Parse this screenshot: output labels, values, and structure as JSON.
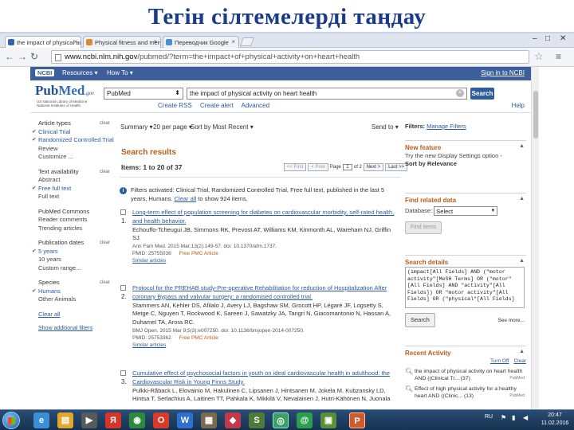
{
  "slide": {
    "title": "Тегін сілтемелерді таңдау"
  },
  "browser": {
    "tabs": [
      {
        "label": "the impact of physical act",
        "active": true
      },
      {
        "label": "Physical fitness and mental",
        "active": false
      },
      {
        "label": "Переводчик Google",
        "active": false
      }
    ],
    "url_host": "www.ncbi.nlm.nih.gov",
    "url_path": "/pubmed/?term=the+impact+of+physical+activity+on+heart+health"
  },
  "ncbi_bar": {
    "logo": "NCBI",
    "resources": "Resources ▾",
    "howto": "How To ▾",
    "signin": "Sign in to NCBI"
  },
  "pubmed": {
    "logo_pub": "Pub",
    "logo_med": "Med",
    "logo_gov": ".gov",
    "subtitle": "US National Library of Medicine National Institutes of Health",
    "db_select": "PubMed",
    "query": "the impact of physical activity on heart health",
    "search_label": "Search",
    "links": [
      "Create RSS",
      "Create alert",
      "Advanced"
    ],
    "help": "Help"
  },
  "sidebar": {
    "groups": [
      {
        "head": "Article types",
        "clear": "clear",
        "items": [
          {
            "label": "Clinical Trial",
            "sel": true
          },
          {
            "label": "Randomized Controlled Trial",
            "sel": true
          },
          {
            "label": "Review",
            "sel": false
          },
          {
            "label": "Customize ...",
            "sel": false
          }
        ]
      },
      {
        "head": "Text availability",
        "clear": "clear",
        "items": [
          {
            "label": "Abstract",
            "sel": false
          },
          {
            "label": "Free full text",
            "sel": true
          },
          {
            "label": "Full text",
            "sel": false
          }
        ]
      },
      {
        "head": "PubMed Commons",
        "clear": "",
        "items": [
          {
            "label": "Reader comments",
            "sel": false
          },
          {
            "label": "Trending articles",
            "sel": false
          }
        ]
      },
      {
        "head": "Publication dates",
        "clear": "clear",
        "items": [
          {
            "label": "5 years",
            "sel": true
          },
          {
            "label": "10 years",
            "sel": false
          },
          {
            "label": "Custom range...",
            "sel": false
          }
        ]
      },
      {
        "head": "Species",
        "clear": "clear",
        "items": [
          {
            "label": "Humans",
            "sel": true
          },
          {
            "label": "Other Animals",
            "sel": false
          }
        ]
      }
    ],
    "clear_all": "Clear all",
    "show_additional": "Show additional filters"
  },
  "results": {
    "summary": "Summary ▾",
    "per_page": "20 per page ▾",
    "sort": "Sort by Most Recent ▾",
    "send_to": "Send to ▾",
    "heading": "Search results",
    "items_line": "Items: 1 to 20 of 37",
    "pager": {
      "first": "<< First",
      "prev": "< Prev",
      "page_label": "Page",
      "page": "1",
      "of": "of 2",
      "next": "Next >",
      "last": "Last >>"
    },
    "filter_note": "Filters activated: Clinical Trial, Randomized Controlled Trial, Free full text, published in the last 5 years, Humans.",
    "filter_clear": "Clear all",
    "filter_tail": "to show 924 items.",
    "list": [
      {
        "num": "1.",
        "title": "Long-term effect of population screening for diabetes on cardiovascular morbidity, self-rated health, and health behavior.",
        "authors": "Echouffo-Tcheugui JB, Simmons RK, Prevost AT, Williams KM, Kinmonth AL, Wareham NJ, Griffin SJ.",
        "source": "Ann Fam Med. 2015 Mar;13(2):149-57. doi: 10.1370/afm.1737.",
        "pmid": "PMID: 25755036",
        "free": "Free PMC Article",
        "similar": "Similar articles"
      },
      {
        "num": "2.",
        "title": "Protocol for the PREHAB study-Pre-operative Rehabilitation for reduction of Hospitalization After coronary Bypass and valvular surgery: a randomised controlled trial.",
        "authors": "Stammers AN, Kehler DS, Afilalo J, Avery LJ, Bagshaw SM, Grocott HP, Légaré JF, Logsetty S, Metge C, Nguyen T, Rockwood K, Sareen J, Sawatzky JA, Tangri N, Giacomantonio N, Hassan A, Duhamel TA, Arora RC.",
        "source": "BMJ Open. 2015 Mar 9;5(3):e007250. doi: 10.1136/bmjopen-2014-007250.",
        "pmid": "PMID: 25753362",
        "free": "Free PMC Article",
        "similar": "Similar articles"
      },
      {
        "num": "3.",
        "title": "Cumulative effect of psychosocial factors in youth on ideal cardiovascular health in adulthood: the Cardiovascular Risk in Young Finns Study.",
        "authors": "Pulkki-Råback L, Elovainio M, Hakulinen C, Lipsanen J, Hintsanen M, Jokela M, Kubzansky LD, Hintsa T, Serlachius A, Laitinen TT, Pahkala K, Mikkilä V, Nevalainen J, Hutri-Kähönen N, Juonala"
      }
    ]
  },
  "right": {
    "filters_label": "Filters:",
    "manage_filters": "Manage Filters",
    "new_feature": {
      "title": "New feature",
      "line1": "Try the new Display Settings option -",
      "line2": "Sort by Relevance"
    },
    "related": {
      "title": "Find related data",
      "db_label": "Database:",
      "db_value": "Select",
      "find_items": "Find items"
    },
    "details": {
      "title": "Search details",
      "query": "(impact[All Fields] AND (\"motor activity\"[MeSH Terms] OR (\"motor\"[All Fields] AND \"activity\"[All Fields]) OR \"motor activity\"[All Fields] OR (\"physical\"[All Fields]",
      "search": "Search",
      "see_more": "See more..."
    },
    "activity": {
      "title": "Recent Activity",
      "turn_off": "Turn Off",
      "clear": "Clear",
      "items": [
        {
          "text": "the impact of physical activity on heart health AND ((Clinical Tr... (37)",
          "tag": "PubMed"
        },
        {
          "text": "Effect of high physical activity for a healthy heart AND ((Clinic... (13)",
          "tag": "PubMed"
        }
      ]
    }
  },
  "taskbar": {
    "lang": "RU",
    "time": "20:47",
    "date": "11.02.2016"
  }
}
